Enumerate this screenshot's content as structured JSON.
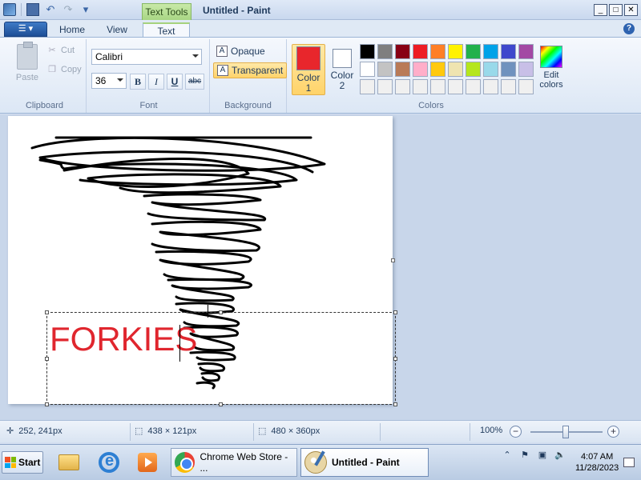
{
  "window": {
    "title": "Untitled - Paint",
    "context_tab": "Text Tools"
  },
  "ribbon_tabs": [
    "Home",
    "View",
    "Text"
  ],
  "active_tab": "Text",
  "clipboard": {
    "paste": "Paste",
    "cut": "Cut",
    "copy": "Copy",
    "group_label": "Clipboard"
  },
  "font": {
    "family": "Calibri",
    "size": "36",
    "bold": "B",
    "italic": "I",
    "underline": "U",
    "strike": "abc",
    "group_label": "Font"
  },
  "background": {
    "opaque": "Opaque",
    "transparent": "Transparent",
    "selected": "Transparent",
    "group_label": "Background"
  },
  "colors": {
    "color1_label_a": "Color",
    "color1_label_b": "1",
    "color2_label_a": "Color",
    "color2_label_b": "2",
    "color1": "#e8262c",
    "color2": "#ffffff",
    "edit_label_a": "Edit",
    "edit_label_b": "colors",
    "group_label": "Colors",
    "palette": [
      "#000000",
      "#7f7f7f",
      "#880015",
      "#ed1c24",
      "#ff7f27",
      "#fff200",
      "#22b14c",
      "#00a2e8",
      "#3f48cc",
      "#a349a4",
      "#ffffff",
      "#c3c3c3",
      "#b97a57",
      "#ffaec9",
      "#ffc90e",
      "#efe4b0",
      "#b5e61d",
      "#99d9ea",
      "#7092be",
      "#c8bfe7",
      "#f0f0f0",
      "#f0f0f0",
      "#f0f0f0",
      "#f0f0f0",
      "#f0f0f0",
      "#f0f0f0",
      "#f0f0f0",
      "#f0f0f0",
      "#f0f0f0",
      "#f0f0f0"
    ]
  },
  "canvas": {
    "text": "FORKIES",
    "text_color": "#e0262e"
  },
  "status": {
    "cursor": "252, 241px",
    "selection": "438 × 121px",
    "size": "480 × 360px",
    "zoom": "100%",
    "zoom_minus": "−",
    "zoom_plus": "+"
  },
  "taskbar": {
    "start": "Start",
    "chrome": "Chrome Web Store - ...",
    "paint": "Untitled - Paint",
    "time": "4:07 AM",
    "date": "11/28/2023"
  }
}
